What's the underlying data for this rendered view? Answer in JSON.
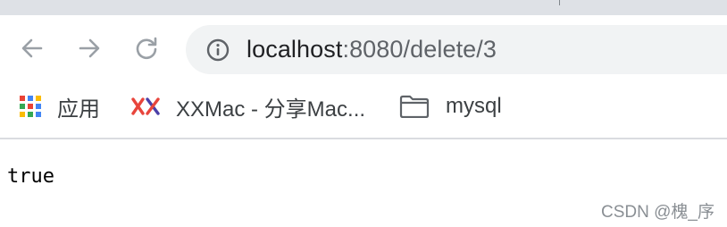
{
  "browser": {
    "toolbar": {
      "back_icon": "arrow-left-icon",
      "forward_icon": "arrow-right-icon",
      "reload_icon": "reload-icon"
    },
    "omnibox": {
      "icon": "info-icon",
      "url_host": "localhost",
      "url_rest": ":8080/delete/3"
    },
    "bookmarks": [
      {
        "label": "应用",
        "icon": "apps-grid-icon"
      },
      {
        "label": "XXMac - 分享Mac...",
        "icon": "xx-logo-icon"
      },
      {
        "label": "mysql",
        "icon": "folder-icon"
      }
    ]
  },
  "page": {
    "body_text": "true"
  },
  "watermark": {
    "text": "CSDN @槐_序"
  },
  "colors": {
    "tabstrip": "#dee1e6",
    "omnibox_bg": "#f1f3f4",
    "icon_gray": "#5f6368",
    "icon_disabled": "#9aa0a6",
    "divider": "#dadce0"
  }
}
